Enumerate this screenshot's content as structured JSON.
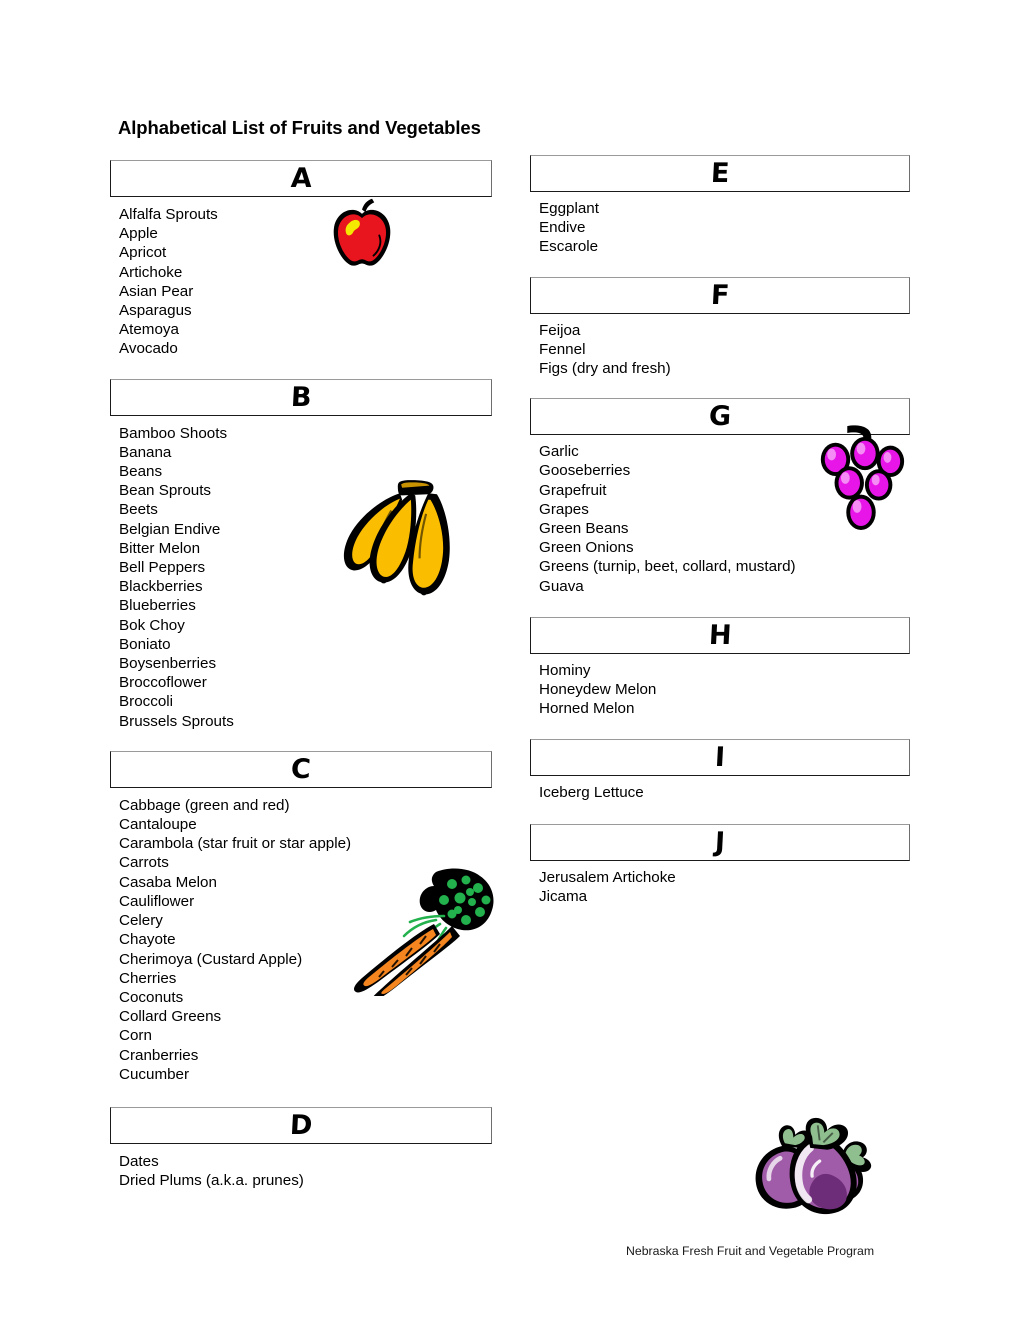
{
  "document": {
    "title": "Alphabetical List of Fruits and Vegetables",
    "footer": "Nebraska Fresh Fruit and Vegetable Program"
  },
  "colors": {
    "text": "#000000",
    "box_border_dark": "#1a1a1a",
    "box_border_light": "#9a9a9a",
    "apple_red": "#E8141E",
    "apple_highlight": "#F5E800",
    "banana_yellow": "#FBBD00",
    "carrot_orange": "#F5861F",
    "carrot_green": "#22B14C",
    "grape_magenta": "#E815E8",
    "grape_light": "#F06EF0",
    "eggplant_purple": "#A05CA8",
    "eggplant_dark": "#6E2D78",
    "eggplant_green": "#8FBF8F"
  },
  "left_column": [
    {
      "letter": "A",
      "items": [
        "Alfalfa Sprouts",
        "Apple",
        "Apricot",
        "Artichoke",
        "Asian Pear",
        "Asparagus",
        "Atemoya",
        "Avocado"
      ]
    },
    {
      "letter": "B",
      "items": [
        "Bamboo Shoots",
        "Banana",
        "Beans",
        "Bean Sprouts",
        "Beets",
        "Belgian Endive",
        "Bitter Melon",
        "Bell Peppers",
        "Blackberries",
        "Blueberries",
        "Bok Choy",
        "Boniato",
        "Boysenberries",
        "Broccoflower",
        "Broccoli",
        "Brussels Sprouts"
      ]
    },
    {
      "letter": "C",
      "items": [
        "Cabbage (green and red)",
        "Cantaloupe",
        "Carambola (star fruit or star apple)",
        "Carrots",
        "Casaba Melon",
        "Cauliflower",
        "Celery",
        "Chayote",
        "Cherimoya (Custard Apple)",
        "Cherries",
        "Coconuts",
        "Collard Greens",
        "Corn",
        "Cranberries",
        "Cucumber"
      ]
    },
    {
      "letter": "D",
      "items": [
        "Dates",
        "Dried Plums (a.k.a. prunes)"
      ]
    }
  ],
  "right_column": [
    {
      "letter": "E",
      "items": [
        "Eggplant",
        "Endive",
        "Escarole"
      ]
    },
    {
      "letter": "F",
      "items": [
        "Feijoa",
        "Fennel",
        "Figs (dry and fresh)"
      ]
    },
    {
      "letter": "G",
      "items": [
        "Garlic",
        "Gooseberries",
        "Grapefruit",
        "Grapes",
        "Green Beans",
        "Green Onions",
        "Greens (turnip, beet, collard, mustard)",
        "Guava"
      ]
    },
    {
      "letter": "H",
      "items": [
        "Hominy",
        "Honeydew Melon",
        "Horned Melon"
      ]
    },
    {
      "letter": "I",
      "items": [
        "Iceberg Lettuce"
      ]
    },
    {
      "letter": "J",
      "items": [
        "Jerusalem Artichoke",
        "Jicama"
      ]
    }
  ],
  "clipart": [
    {
      "name": "apple-clipart",
      "label": "apple"
    },
    {
      "name": "banana-clipart",
      "label": "bananas"
    },
    {
      "name": "carrot-clipart",
      "label": "carrots with greens"
    },
    {
      "name": "grapes-clipart",
      "label": "grapes"
    },
    {
      "name": "eggplant-clipart",
      "label": "eggplants"
    }
  ]
}
